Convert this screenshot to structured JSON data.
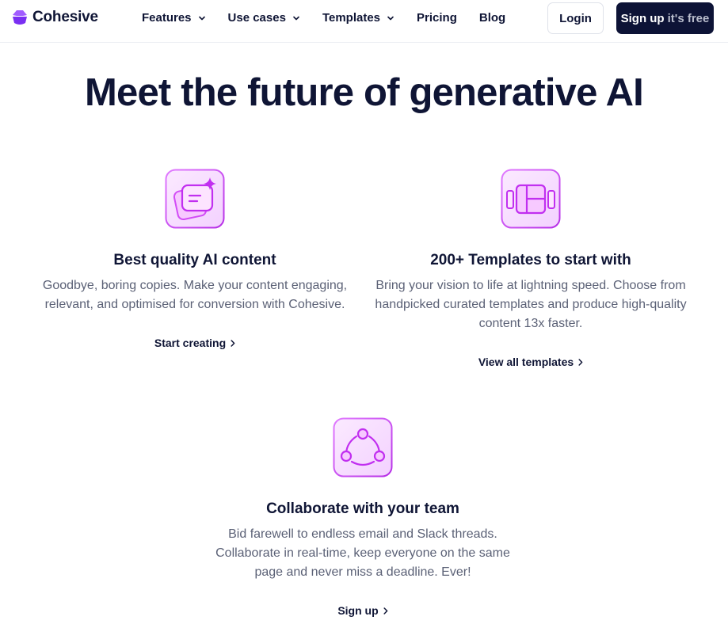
{
  "brand": {
    "name": "Cohesive",
    "logo_color": "#8a3ffc"
  },
  "nav": {
    "items": [
      {
        "label": "Features",
        "has_dropdown": true
      },
      {
        "label": "Use cases",
        "has_dropdown": true
      },
      {
        "label": "Templates",
        "has_dropdown": true
      },
      {
        "label": "Pricing",
        "has_dropdown": false
      },
      {
        "label": "Blog",
        "has_dropdown": false
      }
    ],
    "login_label": "Login",
    "signup_label": "Sign up",
    "signup_suffix": "it's free"
  },
  "hero": {
    "title": "Meet the future of generative AI"
  },
  "features": [
    {
      "icon": "ai-content-sparkle-icon",
      "title": "Best quality AI content",
      "description": "Goodbye, boring copies. Make your content engaging, relevant, and optimised for conversion with Cohesive.",
      "link": "Start creating"
    },
    {
      "icon": "templates-layout-icon",
      "title": "200+ Templates to start with",
      "description": "Bring your vision to life at lightning speed. Choose from handpicked curated templates and produce high-quality content 13x faster.",
      "link": "View all templates"
    },
    {
      "icon": "collaborate-team-icon",
      "title": "Collaborate with your team",
      "description": "Bid farewell to endless email and Slack threads. Collaborate in real-time, keep everyone on the same page and never miss a deadline. Ever!",
      "link": "Sign up"
    }
  ],
  "colors": {
    "primary_dark": "#0d1336",
    "accent_purple": "#c12ff0",
    "text_muted": "#5b6176"
  }
}
